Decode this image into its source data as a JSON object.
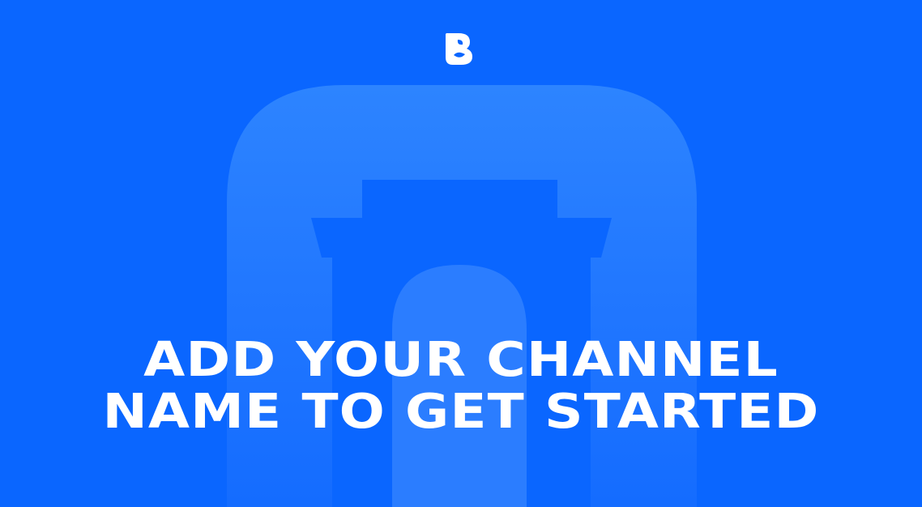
{
  "headline": {
    "line1": "ADD YOUR CHANNEL",
    "line2": "NAME TO GET STARTED"
  },
  "icons": {
    "brand": "brand-b-logo-icon",
    "background": "storefront-app-icon"
  },
  "colors": {
    "background": "#0a66ff",
    "icon_tile": "#2b82ff",
    "text": "#ffffff"
  }
}
